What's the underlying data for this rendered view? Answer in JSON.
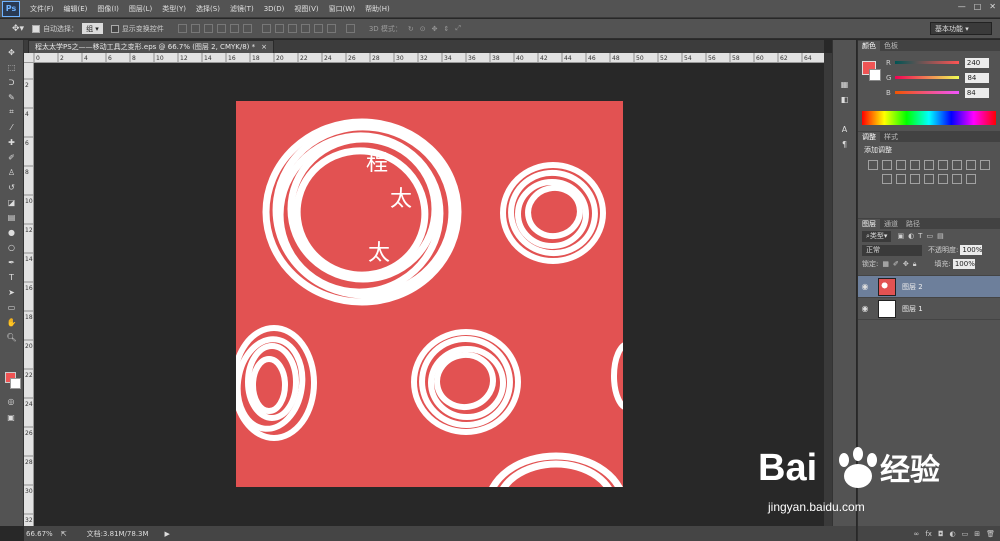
{
  "app": {
    "logo": "Ps"
  },
  "menu": [
    "文件(F)",
    "编辑(E)",
    "图像(I)",
    "图层(L)",
    "类型(Y)",
    "选择(S)",
    "滤镜(T)",
    "3D(D)",
    "视图(V)",
    "窗口(W)",
    "帮助(H)"
  ],
  "window_controls": {
    "minimize": "—",
    "restore": "□",
    "close": "✕"
  },
  "options": {
    "auto_select_label": "自动选择：",
    "auto_select_value": "组",
    "transform_label": "显示变换控件",
    "mode_3d_label": "3D 模式：",
    "workspace": "基本功能"
  },
  "document_tab": {
    "title": "程太太学PS之——移动工具之变形.eps @ 66.7% (图层 2, CMYK/8) *",
    "close": "×"
  },
  "rulers": {
    "horizontal": [
      "0",
      "2",
      "4",
      "6",
      "8",
      "10",
      "12",
      "14",
      "16",
      "18",
      "20",
      "22",
      "24",
      "26",
      "28",
      "30",
      "32",
      "34",
      "36",
      "38",
      "40",
      "42",
      "44",
      "46",
      "48",
      "50",
      "52",
      "54",
      "56",
      "58",
      "60",
      "62",
      "64",
      "66"
    ],
    "vertical": [
      "2",
      "4",
      "6",
      "8",
      "10",
      "12",
      "14",
      "16",
      "18",
      "20",
      "22",
      "24",
      "26",
      "28",
      "30",
      "32"
    ]
  },
  "canvas": {
    "background_color": "#e25252",
    "texts": [
      "程",
      "太",
      "太"
    ]
  },
  "status": {
    "zoom": "66.67%",
    "doc": "文档:3.81M/78.3M",
    "arrow": "▶"
  },
  "color_panel": {
    "tabs": [
      "颜色",
      "色板"
    ],
    "channels": [
      {
        "label": "R",
        "value": "240"
      },
      {
        "label": "G",
        "value": "84"
      },
      {
        "label": "B",
        "value": "84"
      }
    ],
    "foreground": "#f05454"
  },
  "adjustments_panel": {
    "tabs": [
      "调整",
      "样式"
    ],
    "title": "添加调整"
  },
  "layers_panel": {
    "tabs": [
      "图层",
      "通道",
      "路径"
    ],
    "filter_label": "类型",
    "blend_mode": "正常",
    "opacity_label": "不透明度:",
    "opacity_value": "100%",
    "lock_label": "锁定:",
    "fill_label": "填充:",
    "fill_value": "100%",
    "layers": [
      {
        "name": "图层 2",
        "selected": true
      },
      {
        "name": "图层 1",
        "selected": false
      }
    ],
    "footer_icons": [
      "∞",
      "fx",
      "◘",
      "◐",
      "▭",
      "⊞",
      "🗑"
    ]
  },
  "watermark": {
    "brand": "Bai",
    "brand2": "经验",
    "url": "jingyan.baidu.com"
  }
}
